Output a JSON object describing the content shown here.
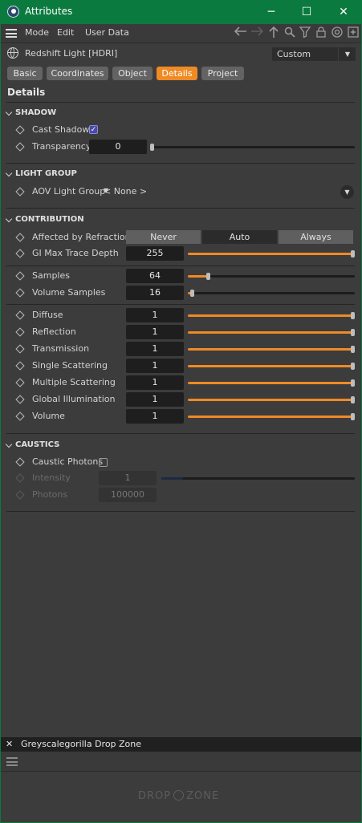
{
  "window": {
    "title": "Attributes",
    "controls": {
      "minimize": "─",
      "maximize": "☐",
      "close": "✕"
    }
  },
  "menubar": {
    "items": [
      "Mode",
      "Edit",
      "User Data"
    ],
    "tool_icons": [
      "arrow-left-icon",
      "arrow-right-icon",
      "arrow-up-icon",
      "search-icon",
      "filter-icon",
      "lock-icon",
      "target-icon",
      "new-panel-icon"
    ]
  },
  "object": {
    "name": "Redshift Light [HDRI]",
    "preset": "Custom",
    "preset_arrow": "▼"
  },
  "tabs": [
    {
      "label": "Basic",
      "active": false
    },
    {
      "label": "Coordinates",
      "active": false
    },
    {
      "label": "Object",
      "active": false
    },
    {
      "label": "Details",
      "active": true
    },
    {
      "label": "Project",
      "active": false
    }
  ],
  "page_title": "Details",
  "shadow": {
    "heading": "SHADOW",
    "cast_shadow": {
      "label": "Cast Shadow",
      "checked": true,
      "check": "✓"
    },
    "transparency": {
      "label": "Transparency",
      "value": "0",
      "fraction": 0.0
    }
  },
  "light_group": {
    "heading": "LIGHT GROUP",
    "aov": {
      "label": "AOV Light Group",
      "value": "< None >",
      "arrow": "▼",
      "circle_arrow": "▼"
    }
  },
  "contribution": {
    "heading": "CONTRIBUTION",
    "refraction": {
      "label": "Affected by Refraction",
      "options": [
        "Never",
        "Auto",
        "Always"
      ],
      "selected": "Auto"
    },
    "gi_max": {
      "label": "GI Max Trace Depth",
      "value": "255",
      "fraction": 1.0
    },
    "samples": {
      "label": "Samples",
      "value": "64",
      "fraction": 0.125
    },
    "volume_samples": {
      "label": "Volume Samples",
      "value": "16",
      "fraction": 0.03
    },
    "multipliers": [
      {
        "label": "Diffuse",
        "value": "1",
        "fraction": 1.0
      },
      {
        "label": "Reflection",
        "value": "1",
        "fraction": 1.0
      },
      {
        "label": "Transmission",
        "value": "1",
        "fraction": 1.0
      },
      {
        "label": "Single Scattering",
        "value": "1",
        "fraction": 1.0
      },
      {
        "label": "Multiple Scattering",
        "value": "1",
        "fraction": 1.0
      },
      {
        "label": "Global Illumination",
        "value": "1",
        "fraction": 1.0
      },
      {
        "label": "Volume",
        "value": "1",
        "fraction": 1.0
      }
    ]
  },
  "caustics": {
    "heading": "CAUSTICS",
    "caustic_photons": {
      "label": "Caustic Photons",
      "checked": false
    },
    "intensity": {
      "label": "Intensity",
      "value": "1",
      "fraction": 0.11,
      "enabled": false
    },
    "photons": {
      "label": "Photons",
      "value": "100000",
      "enabled": false
    }
  },
  "dropzone": {
    "close": "✕",
    "title": "Greyscalegorilla Drop Zone",
    "logo_left": "DROP",
    "logo_right": "ZONE"
  },
  "colors": {
    "accent": "#f08a24",
    "titlebar": "#0b7a3f",
    "panel": "#3c3c3c",
    "field": "#1e1e1e"
  }
}
